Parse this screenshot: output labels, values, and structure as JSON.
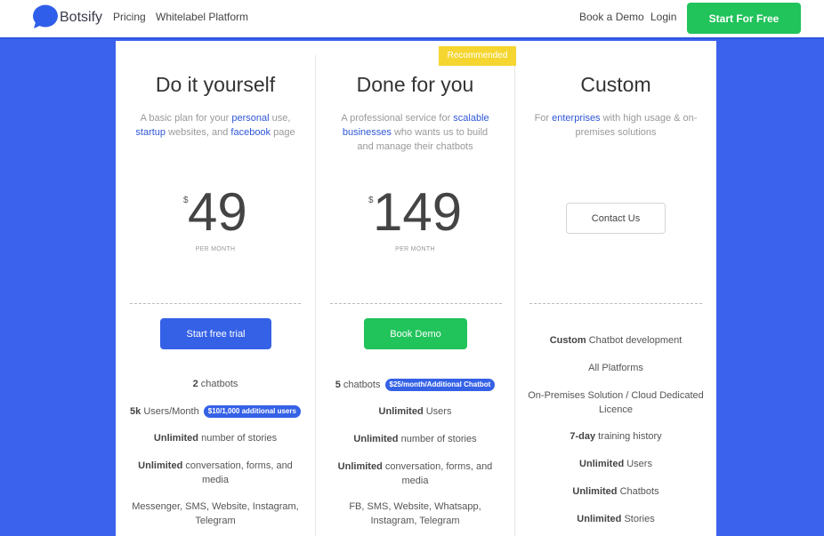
{
  "header": {
    "logo_text": "Botsify",
    "nav": {
      "pricing": "Pricing",
      "whitelabel": "Whitelabel Platform",
      "book_demo": "Book a Demo",
      "login": "Login"
    },
    "cta": "Start For Free"
  },
  "badge": "Recommended",
  "plans": [
    {
      "title": "Do it yourself",
      "desc": [
        "A basic plan for your ",
        "personal",
        " use, ",
        "startup",
        " websites, and ",
        "facebook",
        " page"
      ],
      "currency": "$",
      "price": "49",
      "period": "PER MONTH",
      "cta": "Start free trial",
      "features": [
        {
          "bold": "2",
          "text": " chatbots",
          "pill": ""
        },
        {
          "bold": "5k",
          "text": " Users/Month",
          "pill": "$10/1,000 additional users"
        },
        {
          "bold": "Unlimited",
          "text": " number of stories",
          "pill": ""
        },
        {
          "bold": "Unlimited",
          "text": " conversation, forms, and media",
          "pill": ""
        },
        {
          "bold": "",
          "text": "Messenger, SMS, Website, Instagram, Telegram",
          "pill": ""
        }
      ]
    },
    {
      "title": "Done for you",
      "desc": [
        "A professional service for ",
        "scalable businesses",
        " who wants us to build and manage their chatbots"
      ],
      "currency": "$",
      "price": "149",
      "period": "PER MONTH",
      "cta": "Book Demo",
      "features": [
        {
          "bold": "5",
          "text": " chatbots",
          "pill": "$25/month/Additional Chatbot"
        },
        {
          "bold": "Unlimited",
          "text": " Users",
          "pill": ""
        },
        {
          "bold": "Unlimited",
          "text": " number of stories",
          "pill": ""
        },
        {
          "bold": "Unlimited",
          "text": " conversation, forms, and media",
          "pill": ""
        },
        {
          "bold": "",
          "text": "FB, SMS, Website, Whatsapp, Instagram, Telegram",
          "pill": ""
        }
      ]
    },
    {
      "title": "Custom",
      "desc": [
        "For ",
        "enterprises",
        " with high usage & on-premises solutions"
      ],
      "cta": "Contact Us",
      "features": [
        {
          "bold": "Custom",
          "text": " Chatbot development",
          "pill": ""
        },
        {
          "bold": "",
          "text": "All Platforms",
          "pill": ""
        },
        {
          "bold": "",
          "text": "On-Premises Solution / Cloud Dedicated Licence",
          "pill": ""
        },
        {
          "bold": "7-day",
          "text": " training history",
          "pill": ""
        },
        {
          "bold": "Unlimited",
          "text": " Users",
          "pill": ""
        },
        {
          "bold": "Unlimited",
          "text": " Chatbots",
          "pill": ""
        },
        {
          "bold": "Unlimited",
          "text": " Stories",
          "pill": ""
        }
      ]
    }
  ],
  "colors": {
    "accent_blue": "#3561e6",
    "accent_green": "#21c35b",
    "badge_yellow": "#f5d630",
    "background": "#3b62ec"
  }
}
